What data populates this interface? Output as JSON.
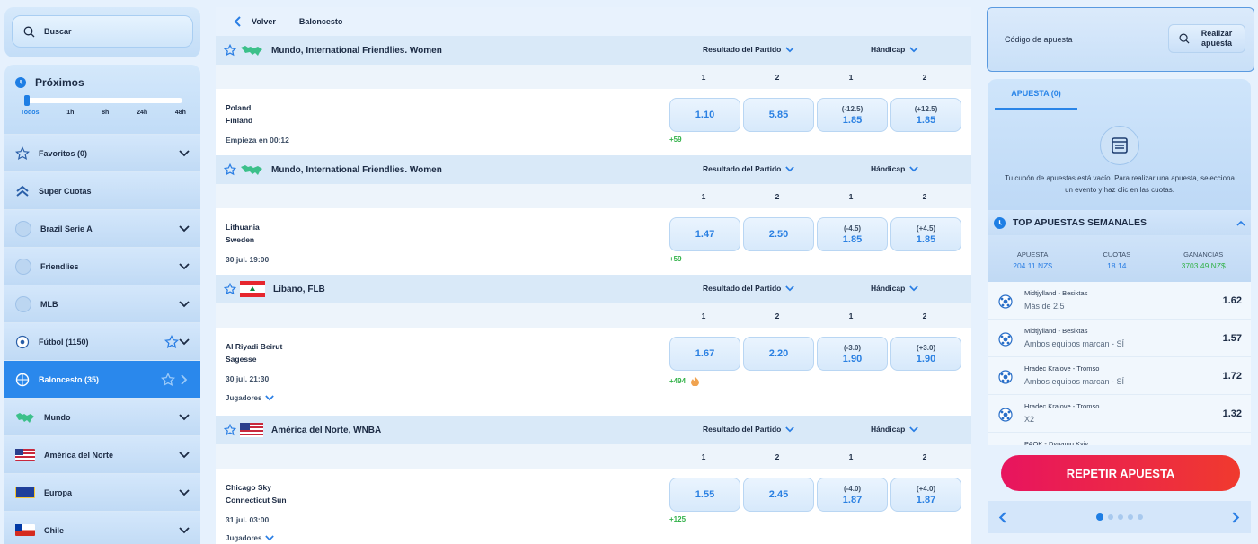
{
  "search": {
    "placeholder": "Buscar"
  },
  "proximos": {
    "title": "Próximos",
    "ticks": [
      "Todos",
      "1h",
      "8h",
      "24h",
      "48h"
    ]
  },
  "sidebar": {
    "items": [
      {
        "label": "Favoritos (0)"
      },
      {
        "label": "Super Cuotas"
      },
      {
        "label": "Brazil Serie A"
      },
      {
        "label": "Friendlies"
      },
      {
        "label": "MLB"
      },
      {
        "label": "Fútbol (1150)"
      },
      {
        "label": "Baloncesto (35)"
      },
      {
        "label": "Mundo"
      },
      {
        "label": "América del Norte"
      },
      {
        "label": "Europa"
      },
      {
        "label": "Chile"
      }
    ]
  },
  "topbar": {
    "back": "Volver",
    "section": "Baloncesto"
  },
  "markets": {
    "result": "Resultado del Partido",
    "handicap": "Hándicap",
    "cols": [
      "1",
      "2",
      "1",
      "2"
    ]
  },
  "events": [
    {
      "league": "Mundo, International Friendlies. Women",
      "home": "Poland",
      "away": "Finland",
      "time": "Empieza en 00:12",
      "odds": [
        "1.10",
        "5.85"
      ],
      "hcp": [
        [
          "(-12.5)",
          "1.85"
        ],
        [
          "(+12.5)",
          "1.85"
        ]
      ],
      "more": "+59"
    },
    {
      "league": "Mundo, International Friendlies. Women",
      "home": "Lithuania",
      "away": "Sweden",
      "time": "30 jul. 19:00",
      "odds": [
        "1.47",
        "2.50"
      ],
      "hcp": [
        [
          "(-4.5)",
          "1.85"
        ],
        [
          "(+4.5)",
          "1.85"
        ]
      ],
      "more": "+59"
    },
    {
      "league": "Líbano, FLB",
      "home": "Al Riyadi Beirut",
      "away": "Sagesse",
      "time": "30 jul. 21:30",
      "odds": [
        "1.67",
        "2.20"
      ],
      "hcp": [
        [
          "(-3.0)",
          "1.90"
        ],
        [
          "(+3.0)",
          "1.90"
        ]
      ],
      "more": "+494",
      "players": "Jugadores"
    },
    {
      "league": "América del Norte, WNBA",
      "home": "Chicago Sky",
      "away": "Connecticut Sun",
      "time": "31 jul. 03:00",
      "odds": [
        "1.55",
        "2.45"
      ],
      "hcp": [
        [
          "(-4.0)",
          "1.87"
        ],
        [
          "(+4.0)",
          "1.87"
        ]
      ],
      "more": "+125",
      "players": "Jugadores"
    }
  ],
  "right": {
    "code_placeholder": "Código de apuesta",
    "place_bet": "Realizar apuesta",
    "tab": "APUESTA (0)",
    "empty": "Tu cupón de apuestas está vacío. Para realizar una apuesta, selecciona un evento y haz clic en las cuotas.",
    "top_title": "TOP APUESTAS SEMANALES",
    "stats": [
      {
        "label": "APUESTA",
        "value": "204.11 NZ$"
      },
      {
        "label": "CUOTAS",
        "value": "18.14"
      },
      {
        "label": "GANANCIAS",
        "value": "3703.49 NZ$"
      }
    ],
    "bets": [
      {
        "match": "Midtjylland - Besiktas",
        "sel": "Más de 2.5",
        "odd": "1.62"
      },
      {
        "match": "Midtjylland - Besiktas",
        "sel": "Ambos equipos marcan - SÍ",
        "odd": "1.57"
      },
      {
        "match": "Hradec Kralove - Tromso",
        "sel": "Ambos equipos marcan - SÍ",
        "odd": "1.72"
      },
      {
        "match": "Hradec Kralove - Tromso",
        "sel": "X2",
        "odd": "1.32"
      },
      {
        "match": "PAOK - Dynamo Kyiv",
        "sel": "",
        "odd": ""
      }
    ],
    "repeat": "REPETIR APUESTA"
  },
  "colors": {
    "accent": "#1e7ee4",
    "positive": "#33b24a",
    "cta": "#e8145f"
  }
}
